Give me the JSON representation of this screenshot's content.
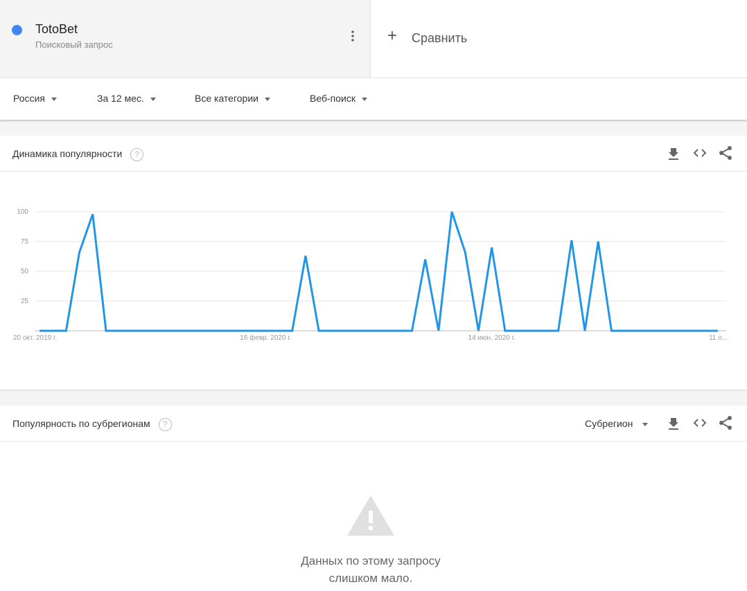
{
  "term": {
    "name": "TotoBet",
    "type": "Поисковый запрос",
    "color": "#4285f4"
  },
  "compare_label": "Сравнить",
  "filters": [
    "Россия",
    "За 12 мес.",
    "Все категории",
    "Веб-поиск"
  ],
  "interest": {
    "title": "Динамика популярности",
    "help": "?"
  },
  "chart_data": {
    "type": "line",
    "title": "Динамика популярности",
    "ylim": [
      0,
      100
    ],
    "yticks": [
      "100",
      "75",
      "50",
      "25"
    ],
    "ytick_values": [
      100,
      75,
      50,
      25
    ],
    "xtick_labels": [
      "20 окт. 2019 г.",
      "16 февр. 2020 г.",
      "14 июн. 2020 г.",
      "11 о..."
    ],
    "xtick_index": [
      0,
      17,
      34,
      51
    ],
    "series": [
      {
        "name": "TotoBet",
        "color": "#2196e6",
        "values": [
          0,
          0,
          0,
          66,
          98,
          0,
          0,
          0,
          0,
          0,
          0,
          0,
          0,
          0,
          0,
          0,
          0,
          0,
          0,
          0,
          63,
          0,
          0,
          0,
          0,
          0,
          0,
          0,
          0,
          60,
          0,
          100,
          66,
          0,
          70,
          0,
          0,
          0,
          0,
          0,
          76,
          0,
          75,
          0,
          0,
          0,
          0,
          0,
          0,
          0,
          0,
          0
        ]
      }
    ]
  },
  "region": {
    "title": "Популярность по субрегионам",
    "help": "?",
    "select": "Субрегион",
    "empty_line1": "Данных по этому запросу",
    "empty_line2": "слишком мало."
  }
}
